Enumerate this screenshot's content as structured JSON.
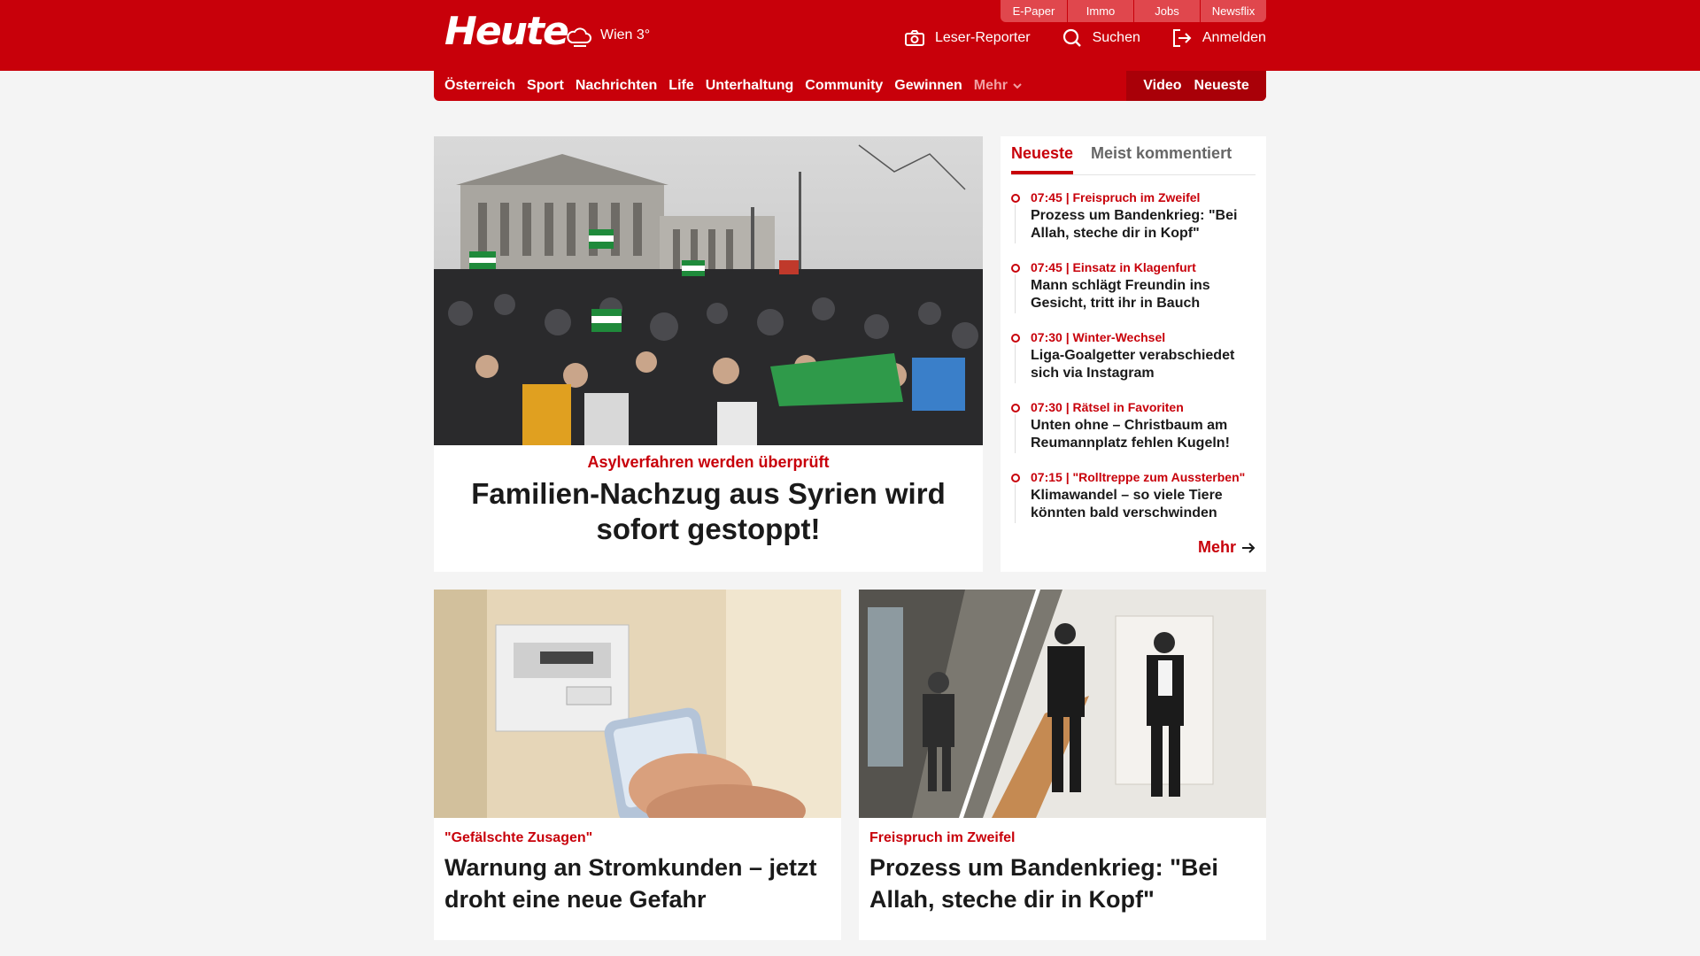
{
  "header": {
    "logo": "Heute",
    "weather": "Wien 3°",
    "service_tabs": [
      "E-Paper",
      "Immo",
      "Jobs",
      "Newsflix"
    ],
    "actions": {
      "reporter": "Leser-Reporter",
      "search": "Suchen",
      "login": "Anmelden"
    }
  },
  "nav": {
    "items": [
      "Österreich",
      "Sport",
      "Nachrichten",
      "Life",
      "Unterhaltung",
      "Community",
      "Gewinnen"
    ],
    "more": "Mehr",
    "right": [
      "Video",
      "Neueste"
    ]
  },
  "hero": {
    "kicker": "Asylverfahren werden überprüft",
    "title": "Familien-Nachzug aus Syrien wird sofort gestoppt!"
  },
  "sidebar": {
    "tabs": [
      "Neueste",
      "Meist kommentiert"
    ],
    "items": [
      {
        "meta": "07:45 | Freispruch im Zweifel",
        "title": "Prozess um Bandenkrieg: \"Bei Allah, steche dir in Kopf\""
      },
      {
        "meta": "07:45 | Einsatz in Klagenfurt",
        "title": "Mann schlägt Freundin ins Gesicht, tritt ihr in Bauch"
      },
      {
        "meta": "07:30 | Winter-Wechsel",
        "title": "Liga-Goalgetter verabschiedet sich via Instagram"
      },
      {
        "meta": "07:30 | Rätsel in Favoriten",
        "title": "Unten ohne – Christbaum am Reumannplatz fehlen Kugeln!"
      },
      {
        "meta": "07:15 | \"Rolltreppe zum Aussterben\"",
        "title": "Klimawandel – so viele Tiere könnten bald verschwinden"
      }
    ],
    "more": "Mehr"
  },
  "cards": [
    {
      "kicker": "\"Gefälschte Zusagen\"",
      "title": "Warnung an Stromkunden – jetzt droht eine neue Gefahr"
    },
    {
      "kicker": "Freispruch im Zweifel",
      "title": "Prozess um Bandenkrieg: \"Bei Allah, steche dir in Kopf\""
    }
  ],
  "colors": {
    "brand_red": "#c8000a",
    "background": "#f4f4f4"
  }
}
